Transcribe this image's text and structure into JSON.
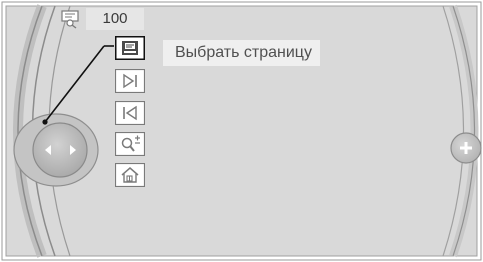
{
  "header": {
    "zoom_icon": "zoom-level-icon",
    "zoom_value": "100"
  },
  "tooltip": {
    "label": "Выбрать страницу"
  },
  "toolbar": {
    "items": [
      {
        "icon": "page-select-icon",
        "selected": true
      },
      {
        "icon": "skip-forward-icon",
        "selected": false
      },
      {
        "icon": "skip-back-icon",
        "selected": false
      },
      {
        "icon": "zoom-icon",
        "selected": false
      },
      {
        "icon": "home-icon",
        "selected": false
      }
    ]
  },
  "controller": {
    "left_arrow_icon": "arrow-left-icon",
    "right_arrow_icon": "arrow-right-icon",
    "plus_icon": "plus-icon"
  },
  "colors": {
    "background": "#d9d9d9",
    "panel_border": "#9a9a9a",
    "selected_frame": "#1a1a1a",
    "icon_fill": "#ffffff",
    "icon_stroke": "#7a7a7a"
  }
}
